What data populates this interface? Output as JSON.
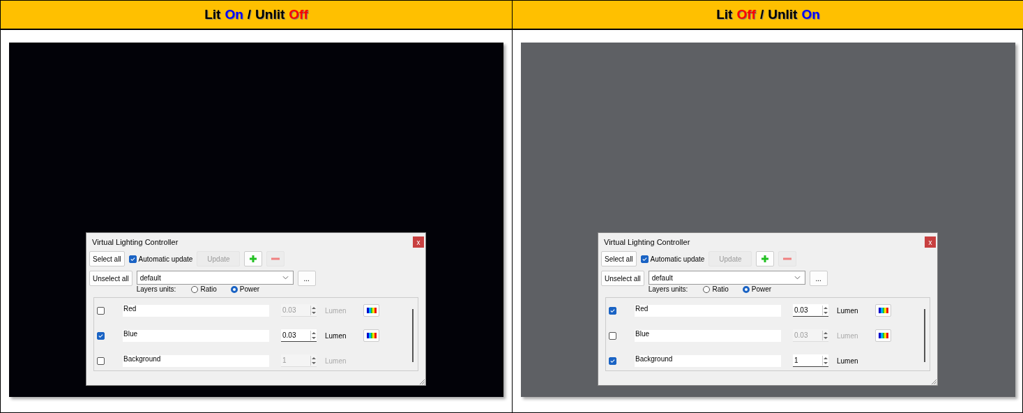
{
  "panels": [
    {
      "header": [
        {
          "text": "Lit",
          "color": "#000000"
        },
        {
          "text": "On",
          "color": "#0000ff"
        },
        {
          "text": "/",
          "color": "#000000"
        },
        {
          "text": "Unlit",
          "color": "#000000"
        },
        {
          "text": "Off",
          "color": "#ff0000"
        }
      ],
      "photo": {
        "kind": "dark"
      },
      "dialog": {
        "title": "Virtual Lighting Controller",
        "close": "x",
        "select_all": "Select all",
        "auto_update": {
          "label": "Automatic update",
          "checked": true
        },
        "update": "Update",
        "unselect_all": "Unselect all",
        "preset": "default",
        "more": "...",
        "units_label": "Layers units:",
        "units": [
          {
            "label": "Ratio",
            "selected": false
          },
          {
            "label": "Power",
            "selected": true
          }
        ],
        "layers": [
          {
            "name": "Red",
            "checked": false,
            "value": "0.03",
            "unit": "Lumen",
            "color_button": true
          },
          {
            "name": "Blue",
            "checked": true,
            "value": "0.03",
            "unit": "Lumen",
            "color_button": true
          },
          {
            "name": "Background",
            "checked": false,
            "value": "1",
            "unit": "Lumen",
            "color_button": false
          }
        ]
      }
    },
    {
      "header": [
        {
          "text": "Lit",
          "color": "#000000"
        },
        {
          "text": "Off",
          "color": "#ff0000"
        },
        {
          "text": "/",
          "color": "#000000"
        },
        {
          "text": "Unlit",
          "color": "#000000"
        },
        {
          "text": "On",
          "color": "#0000ff"
        }
      ],
      "photo": {
        "kind": "grey"
      },
      "dialog": {
        "title": "Virtual Lighting Controller",
        "close": "x",
        "select_all": "Select all",
        "auto_update": {
          "label": "Automatic update",
          "checked": true
        },
        "update": "Update",
        "unselect_all": "Unselect all",
        "preset": "default",
        "more": "...",
        "units_label": "Layers units:",
        "units": [
          {
            "label": "Ratio",
            "selected": false
          },
          {
            "label": "Power",
            "selected": true
          }
        ],
        "layers": [
          {
            "name": "Red",
            "checked": true,
            "value": "0.03",
            "unit": "Lumen",
            "color_button": true
          },
          {
            "name": "Blue",
            "checked": false,
            "value": "0.03",
            "unit": "Lumen",
            "color_button": true
          },
          {
            "name": "Background",
            "checked": true,
            "value": "1",
            "unit": "Lumen",
            "color_button": false
          }
        ]
      }
    }
  ]
}
